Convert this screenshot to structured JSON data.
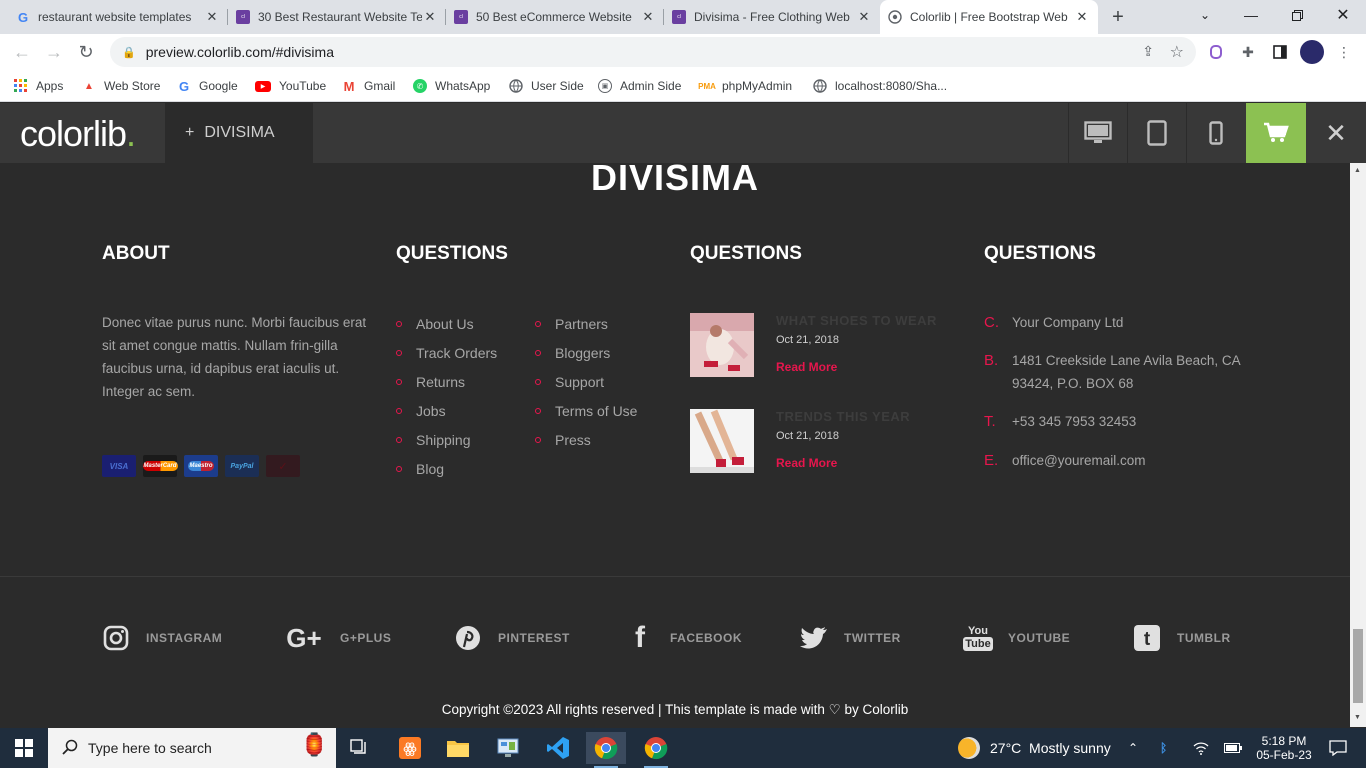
{
  "tabs": [
    {
      "title": "restaurant website templates",
      "favicon": "google-g-icon"
    },
    {
      "title": "30 Best Restaurant Website Te",
      "favicon": "colorlib-icon"
    },
    {
      "title": "50 Best eCommerce Website",
      "favicon": "colorlib-icon"
    },
    {
      "title": "Divisima - Free Clothing Web",
      "favicon": "colorlib-icon"
    },
    {
      "title": "Colorlib | Free Bootstrap Web",
      "favicon": "globe-icon",
      "active": true
    }
  ],
  "address": {
    "url": "preview.colorlib.com/#divisima"
  },
  "bookmarks": [
    {
      "label": "Apps",
      "icon": "apps-grid-icon"
    },
    {
      "label": "Web Store",
      "icon": "web-store-icon"
    },
    {
      "label": "Google",
      "icon": "google-g-icon"
    },
    {
      "label": "YouTube",
      "icon": "youtube-icon"
    },
    {
      "label": "Gmail",
      "icon": "gmail-icon"
    },
    {
      "label": "WhatsApp",
      "icon": "whatsapp-icon"
    },
    {
      "label": "User Side",
      "icon": "globe-icon"
    },
    {
      "label": "Admin Side",
      "icon": "admin-icon"
    },
    {
      "label": "phpMyAdmin",
      "icon": "phpmyadmin-icon"
    },
    {
      "label": "localhost:8080/Sha...",
      "icon": "globe-icon"
    }
  ],
  "preview_bar": {
    "logo": "colorlib",
    "logo_dot": ".",
    "template_name": "DIVISIMA",
    "template_prefix": "+",
    "accent_color": "#8cc152"
  },
  "footer": {
    "brand": "DIVISIMA",
    "about": {
      "heading": "ABOUT",
      "text": "Donec vitae purus nunc. Morbi faucibus erat sit amet congue mattis. Nullam frin-gilla faucibus urna, id dapibus erat iaculis ut. Integer ac sem.",
      "payment_icons": [
        "visa-icon",
        "mastercard-icon",
        "maestro-icon",
        "paypal-icon",
        "verified-icon"
      ],
      "payment_labels": [
        "VISA",
        "MasterCard",
        "Maestro",
        "PayPal",
        "✓"
      ]
    },
    "questions_links": {
      "heading": "QUESTIONS",
      "col1": [
        "About Us",
        "Track Orders",
        "Returns",
        "Jobs",
        "Shipping",
        "Blog"
      ],
      "col2": [
        "Partners",
        "Bloggers",
        "Support",
        "Terms of Use",
        "Press"
      ]
    },
    "questions_posts": {
      "heading": "QUESTIONS",
      "posts": [
        {
          "title": "WHAT SHOES TO WEAR",
          "date": "Oct 21, 2018",
          "more": "Read More"
        },
        {
          "title": "TRENDS THIS YEAR",
          "date": "Oct 21, 2018",
          "more": "Read More"
        }
      ]
    },
    "questions_contact": {
      "heading": "QUESTIONS",
      "items": [
        {
          "letter": "C.",
          "text": "Your Company Ltd"
        },
        {
          "letter": "B.",
          "text": "1481 Creekside Lane Avila Beach, CA 93424, P.O. BOX 68"
        },
        {
          "letter": "T.",
          "text": "+53 345 7953 32453"
        },
        {
          "letter": "E.",
          "text": "office@youremail.com"
        }
      ]
    },
    "social": [
      {
        "label": "INSTAGRAM",
        "icon": "instagram-icon"
      },
      {
        "label": "G+PLUS",
        "icon": "google-plus-icon"
      },
      {
        "label": "PINTEREST",
        "icon": "pinterest-icon"
      },
      {
        "label": "FACEBOOK",
        "icon": "facebook-icon"
      },
      {
        "label": "TWITTER",
        "icon": "twitter-icon"
      },
      {
        "label": "YOUTUBE",
        "icon": "youtube-icon"
      },
      {
        "label": "TUMBLR",
        "icon": "tumblr-icon"
      }
    ],
    "copyright": "Copyright ©2023 All rights reserved | This template is made with ♡ by Colorlib",
    "accent_color": "#e7164d"
  },
  "taskbar": {
    "search_placeholder": "Type here to search",
    "weather": "27°C  Mostly sunny",
    "time": "5:18 PM",
    "date": "05-Feb-23"
  }
}
